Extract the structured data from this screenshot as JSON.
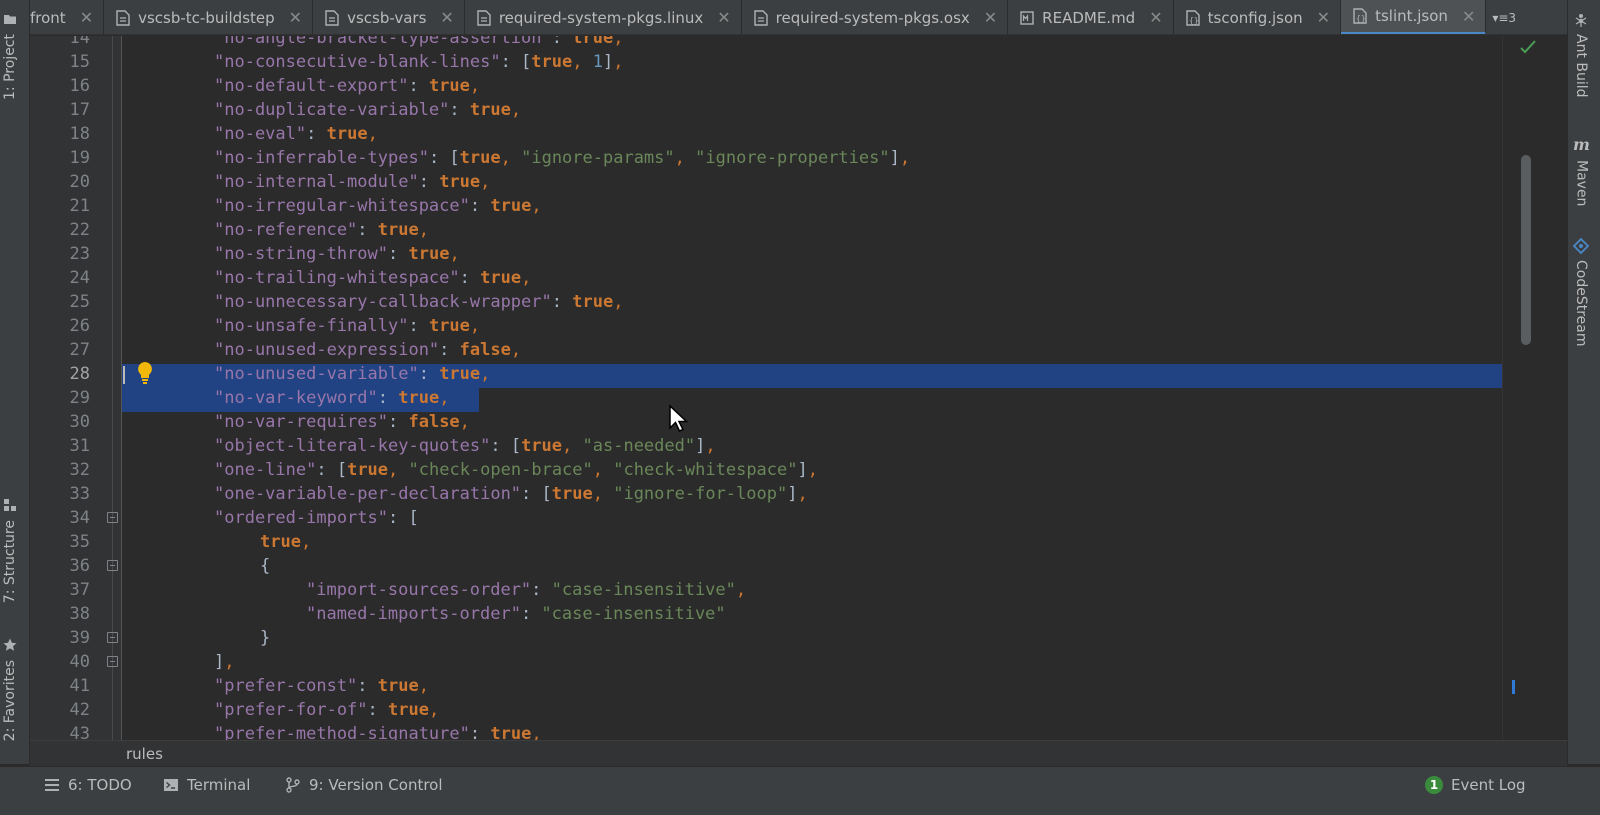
{
  "tabs": [
    {
      "label": "front",
      "icon": "json-file-icon",
      "active": false
    },
    {
      "label": "vscsb-tc-buildstep",
      "icon": "text-file-icon",
      "active": false
    },
    {
      "label": "vscsb-vars",
      "icon": "text-file-icon",
      "active": false
    },
    {
      "label": "required-system-pkgs.linux",
      "icon": "text-file-icon",
      "active": false
    },
    {
      "label": "required-system-pkgs.osx",
      "icon": "text-file-icon",
      "active": false
    },
    {
      "label": "README.md",
      "icon": "markdown-file-icon",
      "active": false
    },
    {
      "label": "tsconfig.json",
      "icon": "json-file-icon",
      "active": false
    },
    {
      "label": "tslint.json",
      "icon": "json-file-icon",
      "active": true
    }
  ],
  "tab_overflow": {
    "count": "3"
  },
  "left_tools": {
    "project": "1: Project",
    "structure": "7: Structure",
    "favorites": "2: Favorites"
  },
  "right_tools": {
    "ant": "Ant Build",
    "maven": "Maven",
    "codestream": "CodeStream"
  },
  "line_numbers": [
    "14",
    "15",
    "16",
    "17",
    "18",
    "19",
    "20",
    "21",
    "22",
    "23",
    "24",
    "25",
    "26",
    "27",
    "28",
    "29",
    "30",
    "31",
    "32",
    "33",
    "34",
    "35",
    "36",
    "37",
    "38",
    "39",
    "40",
    "41",
    "42",
    "43"
  ],
  "current_line": "28",
  "code_lines": [
    "\"no-angle-bracket-type-assertion\": true,",
    "\"no-consecutive-blank-lines\": [true, 1],",
    "\"no-default-export\": true,",
    "\"no-duplicate-variable\": true,",
    "\"no-eval\": true,",
    "\"no-inferrable-types\": [true, \"ignore-params\", \"ignore-properties\"],",
    "\"no-internal-module\": true,",
    "\"no-irregular-whitespace\": true,",
    "\"no-reference\": true,",
    "\"no-string-throw\": true,",
    "\"no-trailing-whitespace\": true,",
    "\"no-unnecessary-callback-wrapper\": true,",
    "\"no-unsafe-finally\": true,",
    "\"no-unused-expression\": false,",
    "\"no-unused-variable\": true,",
    "\"no-var-keyword\": true,",
    "\"no-var-requires\": false,",
    "\"object-literal-key-quotes\": [true, \"as-needed\"],",
    "\"one-line\": [true, \"check-open-brace\", \"check-whitespace\"],",
    "\"one-variable-per-declaration\": [true, \"ignore-for-loop\"],",
    "\"ordered-imports\": [",
    "true,",
    "{",
    "\"import-sources-order\": \"case-insensitive\",",
    "\"named-imports-order\": \"case-insensitive\"",
    "}",
    "],",
    "\"prefer-const\": true,",
    "\"prefer-for-of\": true,",
    "\"prefer-method-signature\": true,"
  ],
  "code_indent": [
    2,
    2,
    2,
    2,
    2,
    2,
    2,
    2,
    2,
    2,
    2,
    2,
    2,
    2,
    2,
    2,
    2,
    2,
    2,
    2,
    2,
    3,
    3,
    4,
    4,
    3,
    2,
    2,
    2,
    2
  ],
  "breadcrumb": "rules",
  "bottom_tools": {
    "todo": "6: TODO",
    "terminal": "Terminal",
    "vcs": "9: Version Control",
    "event_log": "Event Log",
    "event_count": "1"
  },
  "colors": {
    "key": "#9876aa",
    "string": "#6a8759",
    "keyword": "#cc7832",
    "number": "#6897bb",
    "selection": "#214283",
    "accent": "#4a88c7"
  }
}
